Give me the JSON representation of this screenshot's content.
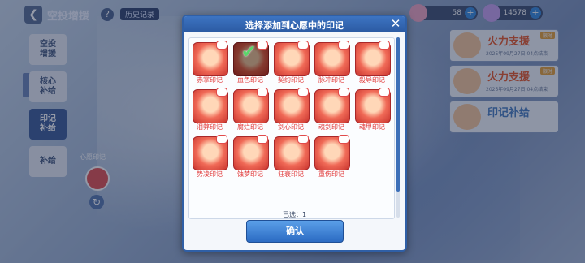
{
  "topbar": {
    "back_icon": "chevron-left-icon",
    "title": "空投增援",
    "help": "?",
    "history": "历史记录",
    "currency1": {
      "icon": "gem-pink-icon",
      "value": "58"
    },
    "currency2": {
      "icon": "crystal-purple-icon",
      "value": "14578"
    },
    "plus": "+"
  },
  "sidebar": {
    "items": [
      {
        "label": "空投\n增援",
        "active": false
      },
      {
        "label": "核心\n补给",
        "active": false
      },
      {
        "label": "印记\n补给",
        "active": true
      },
      {
        "label": "补给",
        "active": false
      }
    ]
  },
  "background": {
    "slot_label": "心愿印记",
    "refresh_icon": "refresh-icon"
  },
  "banners": [
    {
      "title": "火力支援",
      "date": "2025年09月27日 04点结束",
      "tag": "限时"
    },
    {
      "title": "火力支援",
      "date": "2025年09月27日 04点结束",
      "tag": "限时"
    },
    {
      "title": "印记补给",
      "date": "",
      "tag": ""
    }
  ],
  "modal": {
    "title": "选择添加到心愿中的印记",
    "close_icon": "close-icon",
    "items": [
      {
        "name": "赤掌印记",
        "selected": false
      },
      {
        "name": "血色印记",
        "selected": true
      },
      {
        "name": "契约印记",
        "selected": false
      },
      {
        "name": "脉冲印记",
        "selected": false
      },
      {
        "name": "殺导印记",
        "selected": false
      },
      {
        "name": "泪弊印记",
        "selected": false
      },
      {
        "name": "腐烂印记",
        "selected": false
      },
      {
        "name": "剑心印记",
        "selected": false
      },
      {
        "name": "魂剑印记",
        "selected": false
      },
      {
        "name": "魂甲印记",
        "selected": false
      },
      {
        "name": "势凌印记",
        "selected": false
      },
      {
        "name": "蚀梦印记",
        "selected": false
      },
      {
        "name": "狂衰印记",
        "selected": false
      },
      {
        "name": "重伤印记",
        "selected": false
      }
    ],
    "check_icon": "checkmark-icon",
    "selected_text": "已选：1",
    "confirm_label": "确认"
  }
}
